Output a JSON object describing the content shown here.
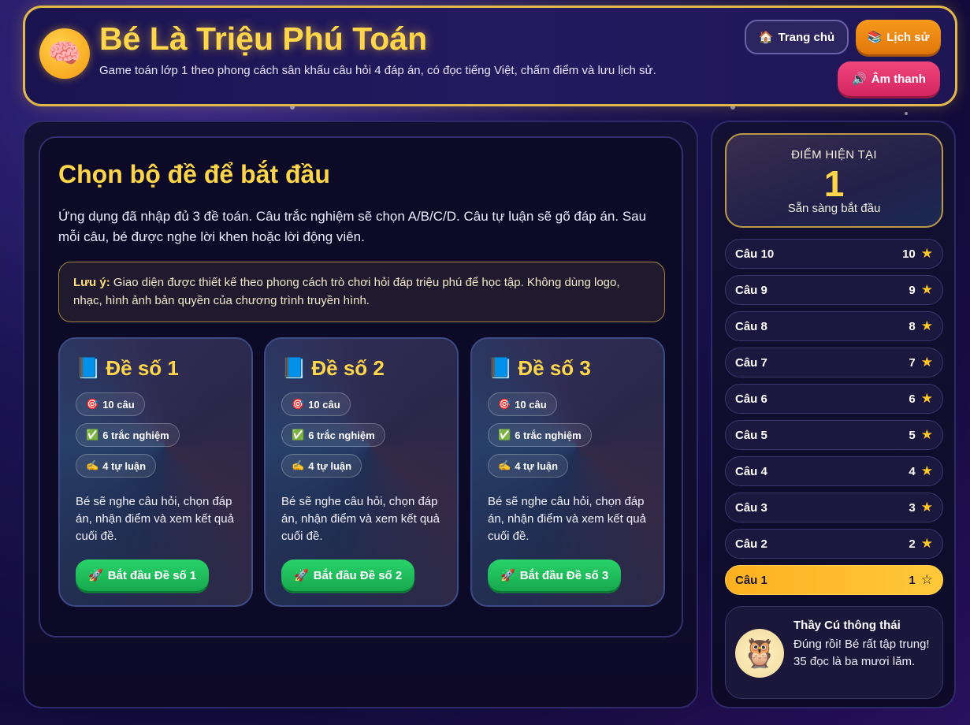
{
  "colors": {
    "accent_gold": "#ffd54a",
    "history_orange": "#f79a1c",
    "sound_pink": "#f0457d",
    "start_green": "#29d36a",
    "active_rung": "#ffb020"
  },
  "header": {
    "logo_icon": "brain-icon",
    "title": "Bé Là Triệu Phú Toán",
    "subtitle": "Game toán lớp 1 theo phong cách sân khấu câu hỏi 4 đáp án, có đọc tiếng Việt, chấm điểm và lưu lịch sử.",
    "buttons": {
      "home": {
        "icon": "🏠",
        "label": "Trang chủ"
      },
      "history": {
        "icon": "📚",
        "label": "Lịch sử"
      },
      "sound": {
        "icon": "🔊",
        "label": "Âm thanh"
      }
    }
  },
  "main": {
    "title": "Chọn bộ đề để bắt đầu",
    "description": "Ứng dụng đã nhập đủ 3 đề toán. Câu trắc nghiệm sẽ chọn A/B/C/D. Câu tự luận sẽ gõ đáp án. Sau mỗi câu, bé được nghe lời khen hoặc lời động viên.",
    "note": {
      "label": "Lưu ý:",
      "text": " Giao diện được thiết kế theo phong cách trò chơi hỏi đáp triệu phú để học tập. Không dùng logo, nhạc, hình ảnh bản quyền của chương trình truyền hình."
    },
    "cards": [
      {
        "icon": "📘",
        "title": "Đề số 1",
        "chips": [
          {
            "icon": "🎯",
            "label": "10 câu"
          },
          {
            "icon": "✅",
            "label": "6 trắc nghiệm"
          },
          {
            "icon": "✍️",
            "label": "4 tự luận"
          }
        ],
        "text": "Bé sẽ nghe câu hỏi, chọn đáp án, nhận điểm và xem kết quả cuối đề.",
        "button": {
          "icon": "🚀",
          "label": "Bắt đầu Đề số 1"
        }
      },
      {
        "icon": "📘",
        "title": "Đề số 2",
        "chips": [
          {
            "icon": "🎯",
            "label": "10 câu"
          },
          {
            "icon": "✅",
            "label": "6 trắc nghiệm"
          },
          {
            "icon": "✍️",
            "label": "4 tự luận"
          }
        ],
        "text": "Bé sẽ nghe câu hỏi, chọn đáp án, nhận điểm và xem kết quả cuối đề.",
        "button": {
          "icon": "🚀",
          "label": "Bắt đầu Đề số 2"
        }
      },
      {
        "icon": "📘",
        "title": "Đề số 3",
        "chips": [
          {
            "icon": "🎯",
            "label": "10 câu"
          },
          {
            "icon": "✅",
            "label": "6 trắc nghiệm"
          },
          {
            "icon": "✍️",
            "label": "4 tự luận"
          }
        ],
        "text": "Bé sẽ nghe câu hỏi, chọn đáp án, nhận điểm và xem kết quả cuối đề.",
        "button": {
          "icon": "🚀",
          "label": "Bắt đầu Đề số 3"
        }
      }
    ]
  },
  "sidebar": {
    "score": {
      "label": "ĐIỂM HIỆN TẠI",
      "value": "1",
      "status": "Sẵn sàng bắt đầu"
    },
    "ladder": [
      {
        "label": "Câu 10",
        "points": "10",
        "active": false
      },
      {
        "label": "Câu 9",
        "points": "9",
        "active": false
      },
      {
        "label": "Câu 8",
        "points": "8",
        "active": false
      },
      {
        "label": "Câu 7",
        "points": "7",
        "active": false
      },
      {
        "label": "Câu 6",
        "points": "6",
        "active": false
      },
      {
        "label": "Câu 5",
        "points": "5",
        "active": false
      },
      {
        "label": "Câu 4",
        "points": "4",
        "active": false
      },
      {
        "label": "Câu 3",
        "points": "3",
        "active": false
      },
      {
        "label": "Câu 2",
        "points": "2",
        "active": false
      },
      {
        "label": "Câu 1",
        "points": "1",
        "active": true
      }
    ],
    "mascot": {
      "icon": "owl-icon",
      "name": "Thầy Cú thông thái",
      "message": "Đúng rồi! Bé rất tập trung! 35 đọc là ba mươi lăm."
    }
  }
}
